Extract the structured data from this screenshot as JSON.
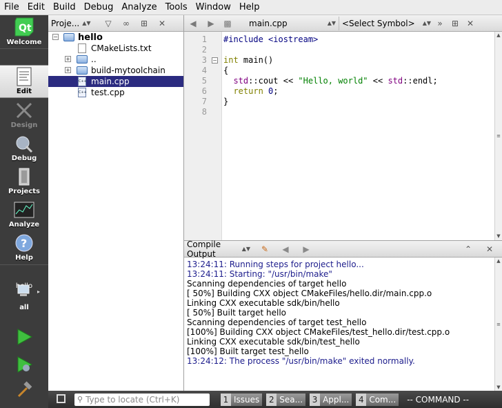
{
  "menubar": [
    "File",
    "Edit",
    "Build",
    "Debug",
    "Analyze",
    "Tools",
    "Window",
    "Help"
  ],
  "modes": {
    "welcome": "Welcome",
    "edit": "Edit",
    "design": "Design",
    "debug": "Debug",
    "projects": "Projects",
    "analyze": "Analyze",
    "help": "Help"
  },
  "kit": {
    "project": "hello",
    "config": "all"
  },
  "project_pane": {
    "view_selector": "Proje...",
    "tree": [
      {
        "label": "hello",
        "type": "project"
      },
      {
        "label": "CMakeLists.txt",
        "type": "file"
      },
      {
        "label": "..",
        "type": "folder"
      },
      {
        "label": "build-mytoolchain",
        "type": "folder"
      },
      {
        "label": "main.cpp",
        "type": "cpp"
      },
      {
        "label": "test.cpp",
        "type": "cpp"
      }
    ]
  },
  "editor": {
    "filename": "main.cpp",
    "symbol": "<Select Symbol>",
    "line_numbers": [
      "1",
      "2",
      "3",
      "4",
      "5",
      "6",
      "7",
      "8"
    ]
  },
  "output": {
    "title": "Compile Output",
    "lines": [
      {
        "text": "13:24:11: Running steps for project hello...",
        "kind": "info"
      },
      {
        "text": "13:24:11: Starting: \"/usr/bin/make\"",
        "kind": "info"
      },
      {
        "text": "Scanning dependencies of target hello",
        "kind": "plain"
      },
      {
        "text": "[ 50%] Building CXX object CMakeFiles/hello.dir/main.cpp.o",
        "kind": "plain"
      },
      {
        "text": "Linking CXX executable sdk/bin/hello",
        "kind": "plain"
      },
      {
        "text": "[ 50%] Built target hello",
        "kind": "plain"
      },
      {
        "text": "Scanning dependencies of target test_hello",
        "kind": "plain"
      },
      {
        "text": "[100%] Building CXX object CMakeFiles/test_hello.dir/test.cpp.o",
        "kind": "plain"
      },
      {
        "text": "Linking CXX executable sdk/bin/test_hello",
        "kind": "plain"
      },
      {
        "text": "[100%] Built target test_hello",
        "kind": "plain"
      },
      {
        "text": "13:24:12: The process \"/usr/bin/make\" exited normally.",
        "kind": "info"
      }
    ]
  },
  "statusbar": {
    "locator_placeholder": "Type to locate (Ctrl+K)",
    "tabs": [
      {
        "num": "1",
        "label": "Issues"
      },
      {
        "num": "2",
        "label": "Sea..."
      },
      {
        "num": "3",
        "label": "Appl..."
      },
      {
        "num": "4",
        "label": "Com..."
      }
    ],
    "mode": "-- COMMAND --"
  },
  "colors": {
    "selection": "#2b2b80",
    "info_text": "#1c1c8c",
    "sidebar": "#3c3c3c"
  }
}
